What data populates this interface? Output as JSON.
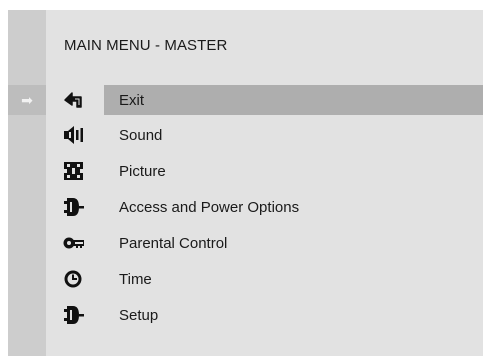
{
  "menu": {
    "title": "MAIN MENU - MASTER",
    "selected_pointer_icon": "right-arrow-icon",
    "items": [
      {
        "label": "Exit",
        "icon": "exit-arrow-icon",
        "selected": true
      },
      {
        "label": "Sound",
        "icon": "speaker-icon",
        "selected": false
      },
      {
        "label": "Picture",
        "icon": "picture-pattern-icon",
        "selected": false
      },
      {
        "label": "Access and Power Options",
        "icon": "power-plug-icon",
        "selected": false
      },
      {
        "label": "Parental Control",
        "icon": "key-icon",
        "selected": false
      },
      {
        "label": "Time",
        "icon": "clock-icon",
        "selected": false
      },
      {
        "label": "Setup",
        "icon": "setup-plug-icon",
        "selected": false
      }
    ]
  },
  "colors": {
    "panel": "#e2e2e2",
    "rail": "#cdcdcd",
    "highlight": "#aeaeae",
    "text": "#1a1a1a"
  }
}
